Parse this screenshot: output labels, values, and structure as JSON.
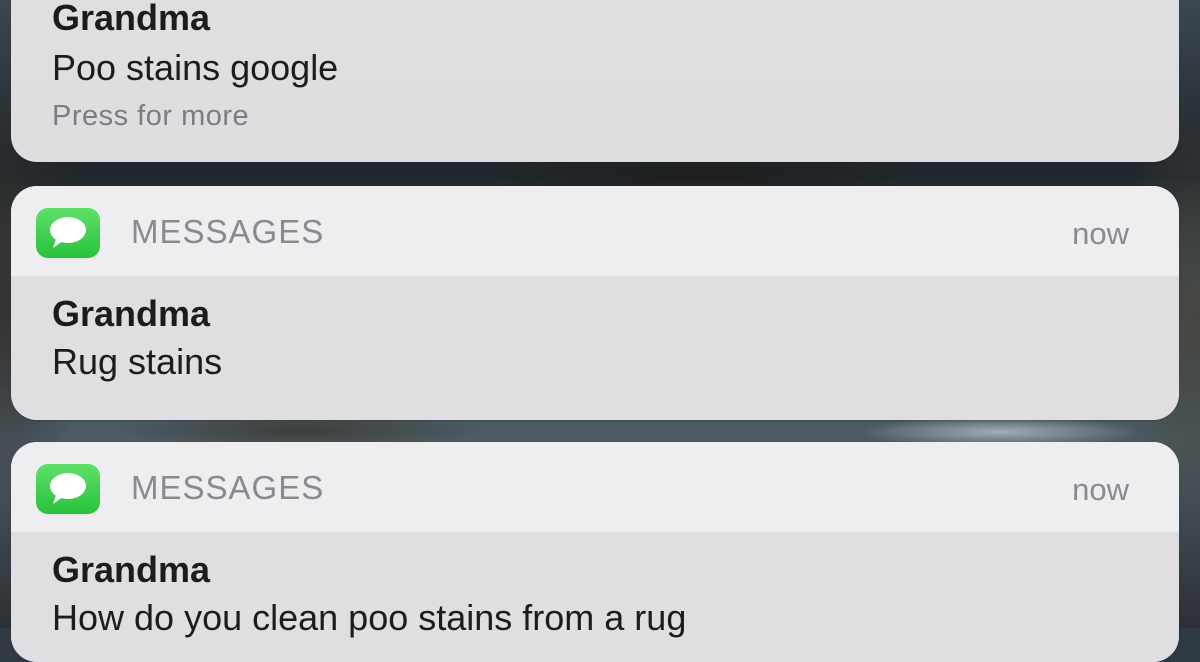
{
  "notifications": [
    {
      "sender": "Grandma",
      "message": "Poo stains google",
      "hint": "Press for more"
    },
    {
      "app": "MESSAGES",
      "app_icon": "messages-icon",
      "time": "now",
      "sender": "Grandma",
      "message": "Rug stains"
    },
    {
      "app": "MESSAGES",
      "app_icon": "messages-icon",
      "time": "now",
      "sender": "Grandma",
      "message": "How do you clean poo stains from a rug"
    }
  ],
  "colors": {
    "icon_green": "#2fc84a",
    "card_bg": "#e2e2e4",
    "secondary_text": "#8a8a8e"
  }
}
